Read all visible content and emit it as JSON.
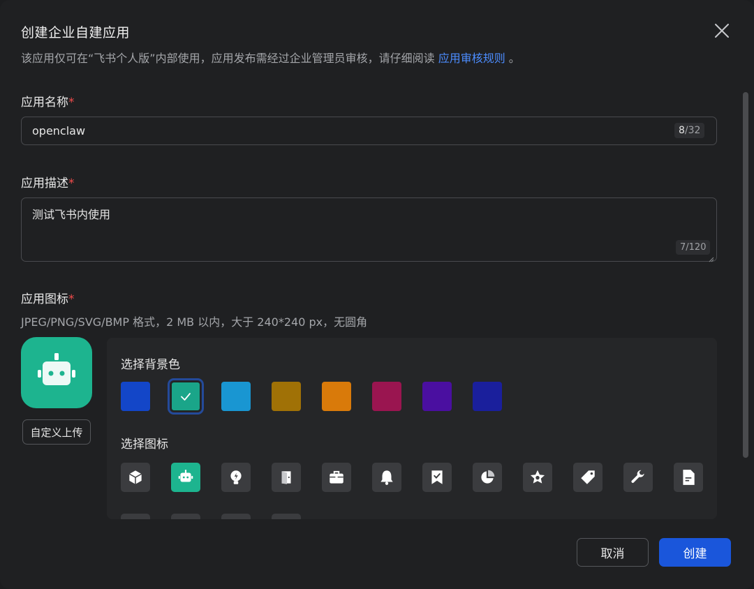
{
  "dialog": {
    "title": "创建企业自建应用",
    "subtitle": "该应用仅可在“飞书个人版”内部使用，应用发布需经过企业管理员审核，请仔细阅读",
    "subtitle_link": "应用审核规则",
    "subtitle_end": "。"
  },
  "fields": {
    "name": {
      "label": "应用名称",
      "required_mark": "*",
      "value": "openclaw",
      "count_current": "8",
      "count_max": "/32"
    },
    "description": {
      "label": "应用描述",
      "required_mark": "*",
      "value": "测试飞书内使用",
      "count": "7/120"
    },
    "icon": {
      "label": "应用图标",
      "required_mark": "*",
      "hint": "JPEG/PNG/SVG/BMP 格式，2 MB 以内，大于 240*240 px，无圆角",
      "upload_label": "自定义上传",
      "preview_bg": "#1db48f"
    }
  },
  "picker": {
    "bg_title": "选择背景色",
    "icon_title": "选择图标",
    "colors": [
      {
        "hex": "#1346c8",
        "selected": false
      },
      {
        "hex": "#1aa589",
        "selected": true
      },
      {
        "hex": "#1996d2",
        "selected": false
      },
      {
        "hex": "#a07106",
        "selected": false
      },
      {
        "hex": "#d97a0a",
        "selected": false
      },
      {
        "hex": "#9a1550",
        "selected": false
      },
      {
        "hex": "#4a0fa0",
        "selected": false
      },
      {
        "hex": "#1a1f9c",
        "selected": false
      }
    ],
    "icons": [
      {
        "name": "cube-icon",
        "selected": false
      },
      {
        "name": "robot-icon",
        "selected": true
      },
      {
        "name": "lightbulb-icon",
        "selected": false
      },
      {
        "name": "door-icon",
        "selected": false
      },
      {
        "name": "briefcase-icon",
        "selected": false
      },
      {
        "name": "bell-icon",
        "selected": false
      },
      {
        "name": "bookmark-check-icon",
        "selected": false
      },
      {
        "name": "pie-chart-icon",
        "selected": false
      },
      {
        "name": "star-icon",
        "selected": false
      },
      {
        "name": "tag-icon",
        "selected": false
      },
      {
        "name": "wrench-icon",
        "selected": false
      },
      {
        "name": "document-icon",
        "selected": false
      }
    ]
  },
  "footer": {
    "cancel_label": "取消",
    "create_label": "创建"
  }
}
